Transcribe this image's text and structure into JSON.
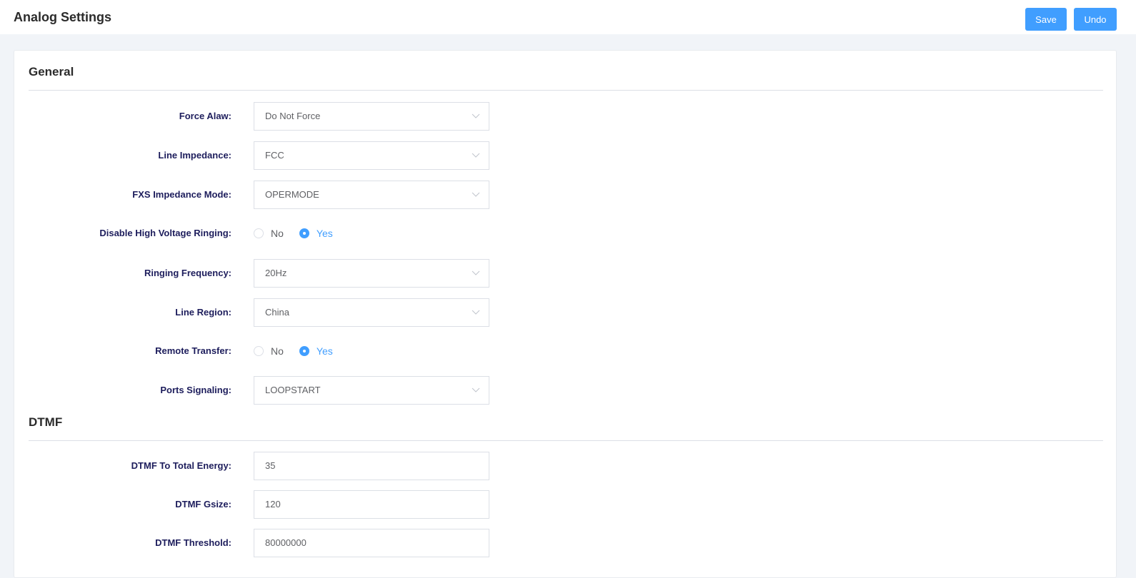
{
  "header": {
    "title": "Analog Settings",
    "save_label": "Save",
    "undo_label": "Undo"
  },
  "general": {
    "title": "General",
    "fields": [
      {
        "label": "Force Alaw:",
        "type": "select",
        "value": "Do Not Force"
      },
      {
        "label": "Line Impedance:",
        "type": "select",
        "value": "FCC"
      },
      {
        "label": "FXS Impedance Mode:",
        "type": "select",
        "value": "OPERMODE"
      },
      {
        "label": "Disable High Voltage Ringing:",
        "type": "radio",
        "options": [
          "No",
          "Yes"
        ],
        "value": "Yes"
      },
      {
        "label": "Ringing Frequency:",
        "type": "select",
        "value": "20Hz"
      },
      {
        "label": "Line Region:",
        "type": "select",
        "value": "China"
      },
      {
        "label": "Remote Transfer:",
        "type": "radio",
        "options": [
          "No",
          "Yes"
        ],
        "value": "Yes"
      },
      {
        "label": "Ports Signaling:",
        "type": "select",
        "value": "LOOPSTART"
      }
    ]
  },
  "dtmf": {
    "title": "DTMF",
    "fields": [
      {
        "label": "DTMF To Total Energy:",
        "type": "input",
        "value": "35"
      },
      {
        "label": "DTMF Gsize:",
        "type": "input",
        "value": "120"
      },
      {
        "label": "DTMF Threshold:",
        "type": "input",
        "value": "80000000"
      }
    ]
  },
  "icons": {
    "dropdown": "chevron-down-icon"
  },
  "colors": {
    "primary": "#409eff",
    "label": "#1d1d5c",
    "background": "#f1f4f8"
  }
}
